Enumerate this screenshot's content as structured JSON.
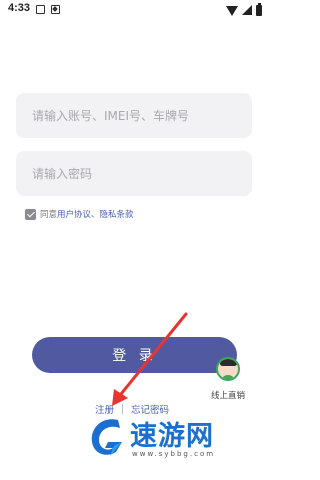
{
  "status_bar": {
    "time": "4:33",
    "left_icons": [
      "gallery-icon",
      "document-icon"
    ],
    "right_icons": [
      "wifi-icon",
      "signal-icon",
      "battery-icon"
    ]
  },
  "login_form": {
    "account_placeholder": "请输入账号、IMEI号、车牌号",
    "account_value": "",
    "password_placeholder": "请输入密码",
    "password_value": "",
    "agree_checked": true,
    "agree_prefix": "同意",
    "user_agreement": "用户协议",
    "separator": "、",
    "privacy_terms": "隐私条款",
    "login_label": "登 录"
  },
  "footer_links": {
    "register": "注册",
    "forgot_password": "忘记密码"
  },
  "online_service": {
    "label": "线上直销"
  },
  "watermark": {
    "site_name": "速游网",
    "url": "www.sybbg.com"
  },
  "colors": {
    "primary": "#515aa0",
    "link": "#4960b0",
    "input_bg": "#f2f2f5",
    "arrow": "#e8342f",
    "watermark": "#1b6fd0"
  }
}
